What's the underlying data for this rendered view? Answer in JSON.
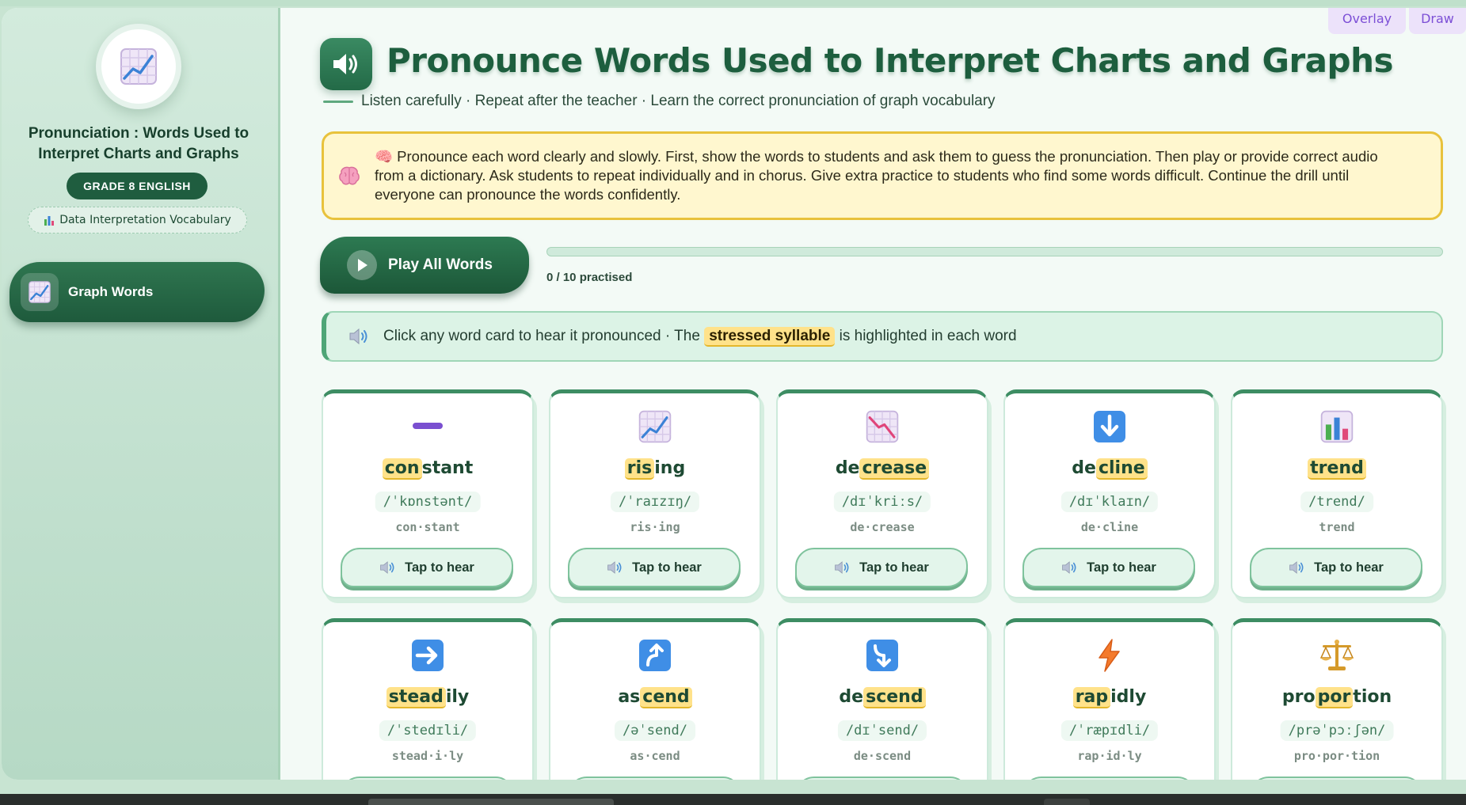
{
  "tools": {
    "overlay": "Overlay",
    "draw": "Draw"
  },
  "sidebar": {
    "title": "Pronunciation : Words Used to Interpret Charts and Graphs",
    "grade": "GRADE 8 ENGLISH",
    "topic": "Data Interpretation Vocabulary",
    "nav": [
      {
        "label": "Graph Words",
        "icon": "chart-increasing-icon"
      }
    ]
  },
  "header": {
    "title": "Pronounce Words Used to Interpret Charts and Graphs",
    "subtitle": "Listen carefully · Repeat after the teacher · Learn the correct pronunciation of graph vocabulary"
  },
  "tip": {
    "text": "🧠 Pronounce each word clearly and slowly. First, show the words to students and ask them to guess the pronunciation. Then play or provide correct audio from a dictionary. Ask students to repeat individually and in chorus. Give extra practice to students who find some words difficult. Continue the drill until everyone can pronounce the words confidently."
  },
  "controls": {
    "play_all": "Play All Words",
    "progress_label": "0 / 10 practised",
    "progress_fraction": 0
  },
  "hint": {
    "before": "Click any word card to hear it pronounced · The",
    "chip": "stressed syllable",
    "after": "is highlighted in each word"
  },
  "tap_label": "Tap to hear",
  "words": [
    {
      "pre": "",
      "stress": "con",
      "post": "stant",
      "ipa": "/ˈkɒnstənt/",
      "syllables": "con·stant",
      "icon": "minus-icon"
    },
    {
      "pre": "",
      "stress": "ris",
      "post": "ing",
      "ipa": "/ˈraɪzɪŋ/",
      "syllables": "ris·ing",
      "icon": "chart-increasing-icon"
    },
    {
      "pre": "de",
      "stress": "crease",
      "post": "",
      "ipa": "/dɪˈkriːs/",
      "syllables": "de·crease",
      "icon": "chart-decreasing-icon"
    },
    {
      "pre": "de",
      "stress": "cline",
      "post": "",
      "ipa": "/dɪˈklaɪn/",
      "syllables": "de·cline",
      "icon": "down-arrow-icon"
    },
    {
      "pre": "",
      "stress": "trend",
      "post": "",
      "ipa": "/trend/",
      "syllables": "trend",
      "icon": "bar-chart-icon"
    },
    {
      "pre": "",
      "stress": "stead",
      "post": "ily",
      "ipa": "/ˈstedɪli/",
      "syllables": "stead·i·ly",
      "icon": "right-arrow-icon"
    },
    {
      "pre": "as",
      "stress": "cend",
      "post": "",
      "ipa": "/əˈsend/",
      "syllables": "as·cend",
      "icon": "up-curve-arrow-icon"
    },
    {
      "pre": "de",
      "stress": "scend",
      "post": "",
      "ipa": "/dɪˈsend/",
      "syllables": "de·scend",
      "icon": "down-curve-arrow-icon"
    },
    {
      "pre": "",
      "stress": "rap",
      "post": "idly",
      "ipa": "/ˈræpɪdli/",
      "syllables": "rap·id·ly",
      "icon": "lightning-icon"
    },
    {
      "pre": "pro",
      "stress": "por",
      "post": "tion",
      "ipa": "/prəˈpɔːʃən/",
      "syllables": "pro·por·tion",
      "icon": "balance-scale-icon"
    }
  ],
  "colors": {
    "brand": "#1f5d3f",
    "accent_yellow": "#ffe28a",
    "background": "#f3faf6"
  }
}
